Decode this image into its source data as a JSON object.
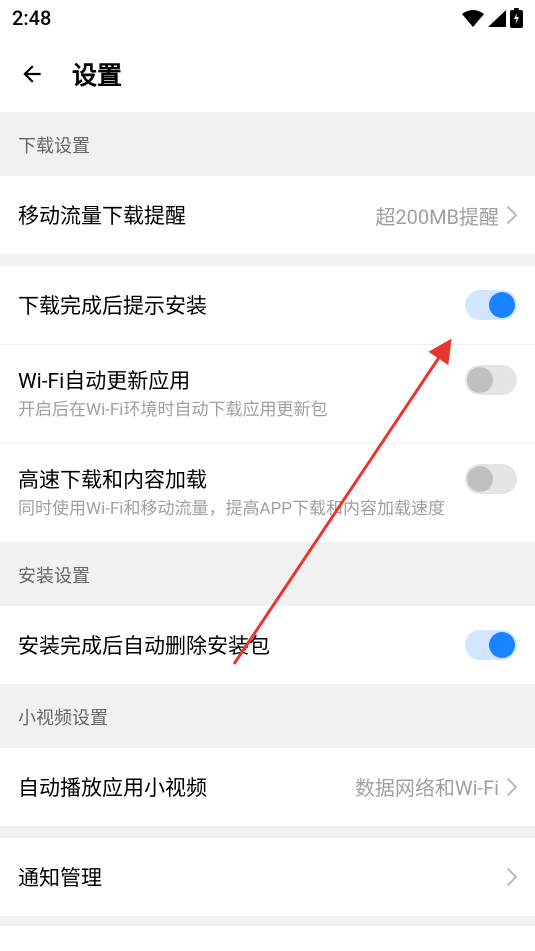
{
  "statusBar": {
    "time": "2:48"
  },
  "header": {
    "title": "设置"
  },
  "sections": {
    "download": {
      "header": "下载设置",
      "mobileDataReminder": {
        "title": "移动流量下载提醒",
        "value": "超200MB提醒"
      },
      "promptInstallAfterDownload": {
        "title": "下载完成后提示安装",
        "enabled": true
      },
      "wifiAutoUpdate": {
        "title": "Wi-Fi自动更新应用",
        "subtitle": "开启后在Wi-Fi环境时自动下载应用更新包",
        "enabled": false
      },
      "highSpeedDownload": {
        "title": "高速下载和内容加载",
        "subtitle": "同时使用Wi-Fi和移动流量，提高APP下载和内容加载速度",
        "enabled": false
      }
    },
    "install": {
      "header": "安装设置",
      "autoDeletePackage": {
        "title": "安装完成后自动删除安装包",
        "enabled": true
      }
    },
    "shortVideo": {
      "header": "小视频设置",
      "autoPlay": {
        "title": "自动播放应用小视频",
        "value": "数据网络和Wi-Fi"
      }
    },
    "notifications": {
      "title": "通知管理"
    }
  }
}
